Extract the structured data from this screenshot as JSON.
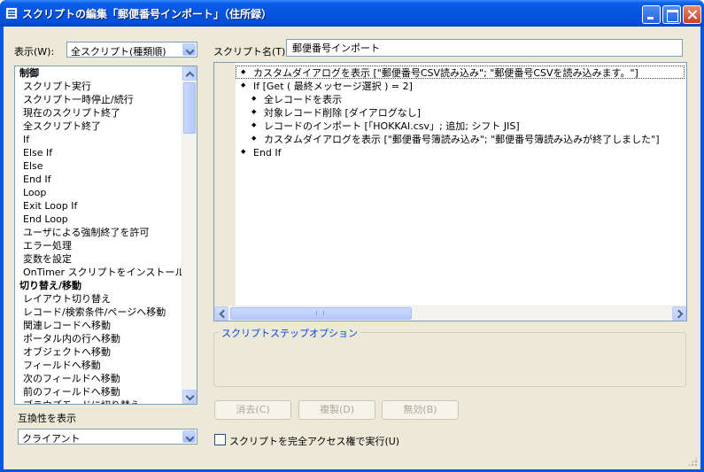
{
  "window": {
    "title": "スクリプトの編集「郵便番号インポート」（住所録）"
  },
  "view": {
    "label": "表示(W):",
    "selected": "全スクリプト(種類順)"
  },
  "script_name": {
    "label": "スクリプト名(T):",
    "value": "郵便番号インポート"
  },
  "step_list": {
    "items": [
      {
        "label": "制御",
        "category": true
      },
      {
        "label": "スクリプト実行",
        "category": false
      },
      {
        "label": "スクリプト一時停止/続行",
        "category": false
      },
      {
        "label": "現在のスクリプト終了",
        "category": false
      },
      {
        "label": "全スクリプト終了",
        "category": false
      },
      {
        "label": "If",
        "category": false
      },
      {
        "label": "Else If",
        "category": false
      },
      {
        "label": "Else",
        "category": false
      },
      {
        "label": "End If",
        "category": false
      },
      {
        "label": "Loop",
        "category": false
      },
      {
        "label": "Exit Loop If",
        "category": false
      },
      {
        "label": "End Loop",
        "category": false
      },
      {
        "label": "ユーザによる強制終了を許可",
        "category": false
      },
      {
        "label": "エラー処理",
        "category": false
      },
      {
        "label": "変数を設定",
        "category": false
      },
      {
        "label": "OnTimer スクリプトをインストール",
        "category": false
      },
      {
        "label": "切り替え/移動",
        "category": true
      },
      {
        "label": "レイアウト切り替え",
        "category": false
      },
      {
        "label": "レコード/検索条件/ページへ移動",
        "category": false
      },
      {
        "label": "関連レコードへ移動",
        "category": false
      },
      {
        "label": "ポータル内の行へ移動",
        "category": false
      },
      {
        "label": "オブジェクトへ移動",
        "category": false
      },
      {
        "label": "フィールドへ移動",
        "category": false
      },
      {
        "label": "次のフィールドへ移動",
        "category": false
      },
      {
        "label": "前のフィールドへ移動",
        "category": false
      },
      {
        "label": "ブラウズモードに切り替え",
        "category": false
      }
    ]
  },
  "script_lines": [
    {
      "text": "カスタムダイアログを表示 [\"郵便番号CSV読み込み\"; \"郵便番号CSVを読み込みます。\"]",
      "indent": 0
    },
    {
      "text": "If [Get ( 最終メッセージ選択 ) = 2]",
      "indent": 0
    },
    {
      "text": "全レコードを表示",
      "indent": 1
    },
    {
      "text": "対象レコード削除 [ダイアログなし]",
      "indent": 1
    },
    {
      "text": "レコードのインポート [「HOKKAI.csv」; 追加; シフト JIS]",
      "indent": 1
    },
    {
      "text": "カスタムダイアログを表示 [\"郵便番号簿読み込み\"; \"郵便番号簿読み込みが終了しました\"]",
      "indent": 1
    },
    {
      "text": "End If",
      "indent": 0
    }
  ],
  "compatibility": {
    "label": "互換性を表示",
    "selected": "クライアント"
  },
  "step_options": {
    "label": "スクリプトステップオプション"
  },
  "buttons": {
    "clear": "消去(C)",
    "duplicate": "複製(D)",
    "disable": "無効(B)"
  },
  "full_access": {
    "label": "スクリプトを完全アクセス権で実行(U)",
    "checked": false
  }
}
